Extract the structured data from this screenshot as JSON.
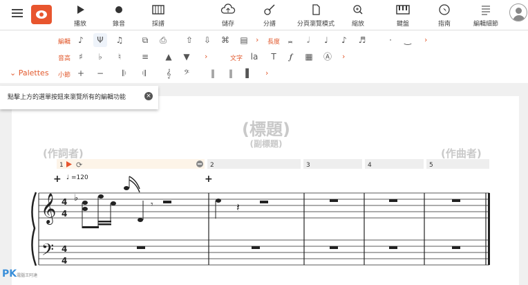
{
  "toolbar": {
    "items": [
      {
        "label": "播放",
        "icon": "play-icon"
      },
      {
        "label": "錄音",
        "icon": "record-icon"
      },
      {
        "label": "採譜",
        "icon": "transcribe-icon"
      },
      {
        "label": "儲存",
        "icon": "cloud-save-icon"
      },
      {
        "label": "分譜",
        "icon": "guitar-icon"
      },
      {
        "label": "分頁瀏覽模式",
        "icon": "page-view-icon"
      },
      {
        "label": "縮放",
        "icon": "zoom-icon"
      },
      {
        "label": "鍵盤",
        "icon": "keyboard-icon"
      },
      {
        "label": "指南",
        "icon": "compass-icon"
      },
      {
        "label": "編輯細節",
        "icon": "details-icon"
      }
    ]
  },
  "edit_rows": {
    "row1_label": "編輯",
    "row1_label2": "長度",
    "row2_label": "音高",
    "row2_label2": "文字",
    "row3_label": "小節",
    "palettes": "Palettes"
  },
  "hint": {
    "text": "點擊上方的選單按鈕來瀏覽所有的編輯功能"
  },
  "score": {
    "title": "(標題)",
    "subtitle": "(副標題)",
    "lyricist": "(作詞者)",
    "composer": "(作曲者)",
    "tempo": "=120",
    "measures": [
      "1",
      "2",
      "3",
      "4",
      "5"
    ]
  },
  "watermark": {
    "text": "PK",
    "small": "電腦王阿達"
  }
}
